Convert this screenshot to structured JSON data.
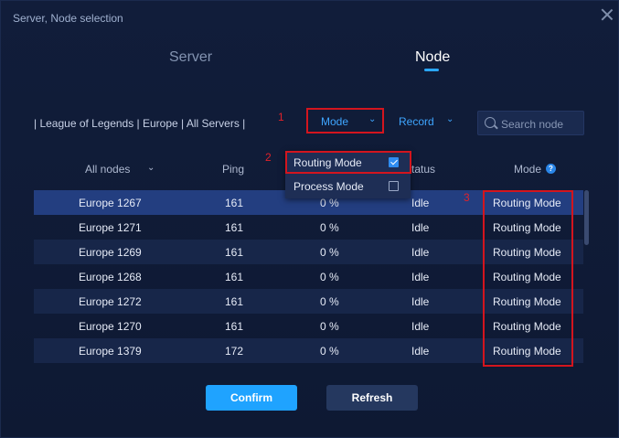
{
  "window": {
    "title": "Server, Node selection"
  },
  "tabs": {
    "server": "Server",
    "node": "Node"
  },
  "breadcrumb": "| League of Legends | Europe | All Servers |",
  "filters": {
    "mode_label": "Mode",
    "record_label": "Record"
  },
  "search": {
    "placeholder": "Search node"
  },
  "table": {
    "headers": {
      "all_nodes": "All nodes",
      "ping": "Ping",
      "status": "tatus",
      "mode": "Mode"
    },
    "rows": [
      {
        "name": "Europe 1267",
        "ping": "161",
        "loss": "0 %",
        "status": "Idle",
        "mode": "Routing Mode"
      },
      {
        "name": "Europe 1271",
        "ping": "161",
        "loss": "0 %",
        "status": "Idle",
        "mode": "Routing Mode"
      },
      {
        "name": "Europe 1269",
        "ping": "161",
        "loss": "0 %",
        "status": "Idle",
        "mode": "Routing Mode"
      },
      {
        "name": "Europe 1268",
        "ping": "161",
        "loss": "0 %",
        "status": "Idle",
        "mode": "Routing Mode"
      },
      {
        "name": "Europe 1272",
        "ping": "161",
        "loss": "0 %",
        "status": "Idle",
        "mode": "Routing Mode"
      },
      {
        "name": "Europe 1270",
        "ping": "161",
        "loss": "0 %",
        "status": "Idle",
        "mode": "Routing Mode"
      },
      {
        "name": "Europe 1379",
        "ping": "172",
        "loss": "0 %",
        "status": "Idle",
        "mode": "Routing Mode"
      }
    ]
  },
  "dropdown": {
    "routing": "Routing Mode",
    "process": "Process Mode"
  },
  "annotations": {
    "a1": "1",
    "a2": "2",
    "a3": "3"
  },
  "buttons": {
    "confirm": "Confirm",
    "refresh": "Refresh"
  },
  "colors": {
    "accent": "#1fa3ff",
    "highlight": "#d3151e"
  }
}
